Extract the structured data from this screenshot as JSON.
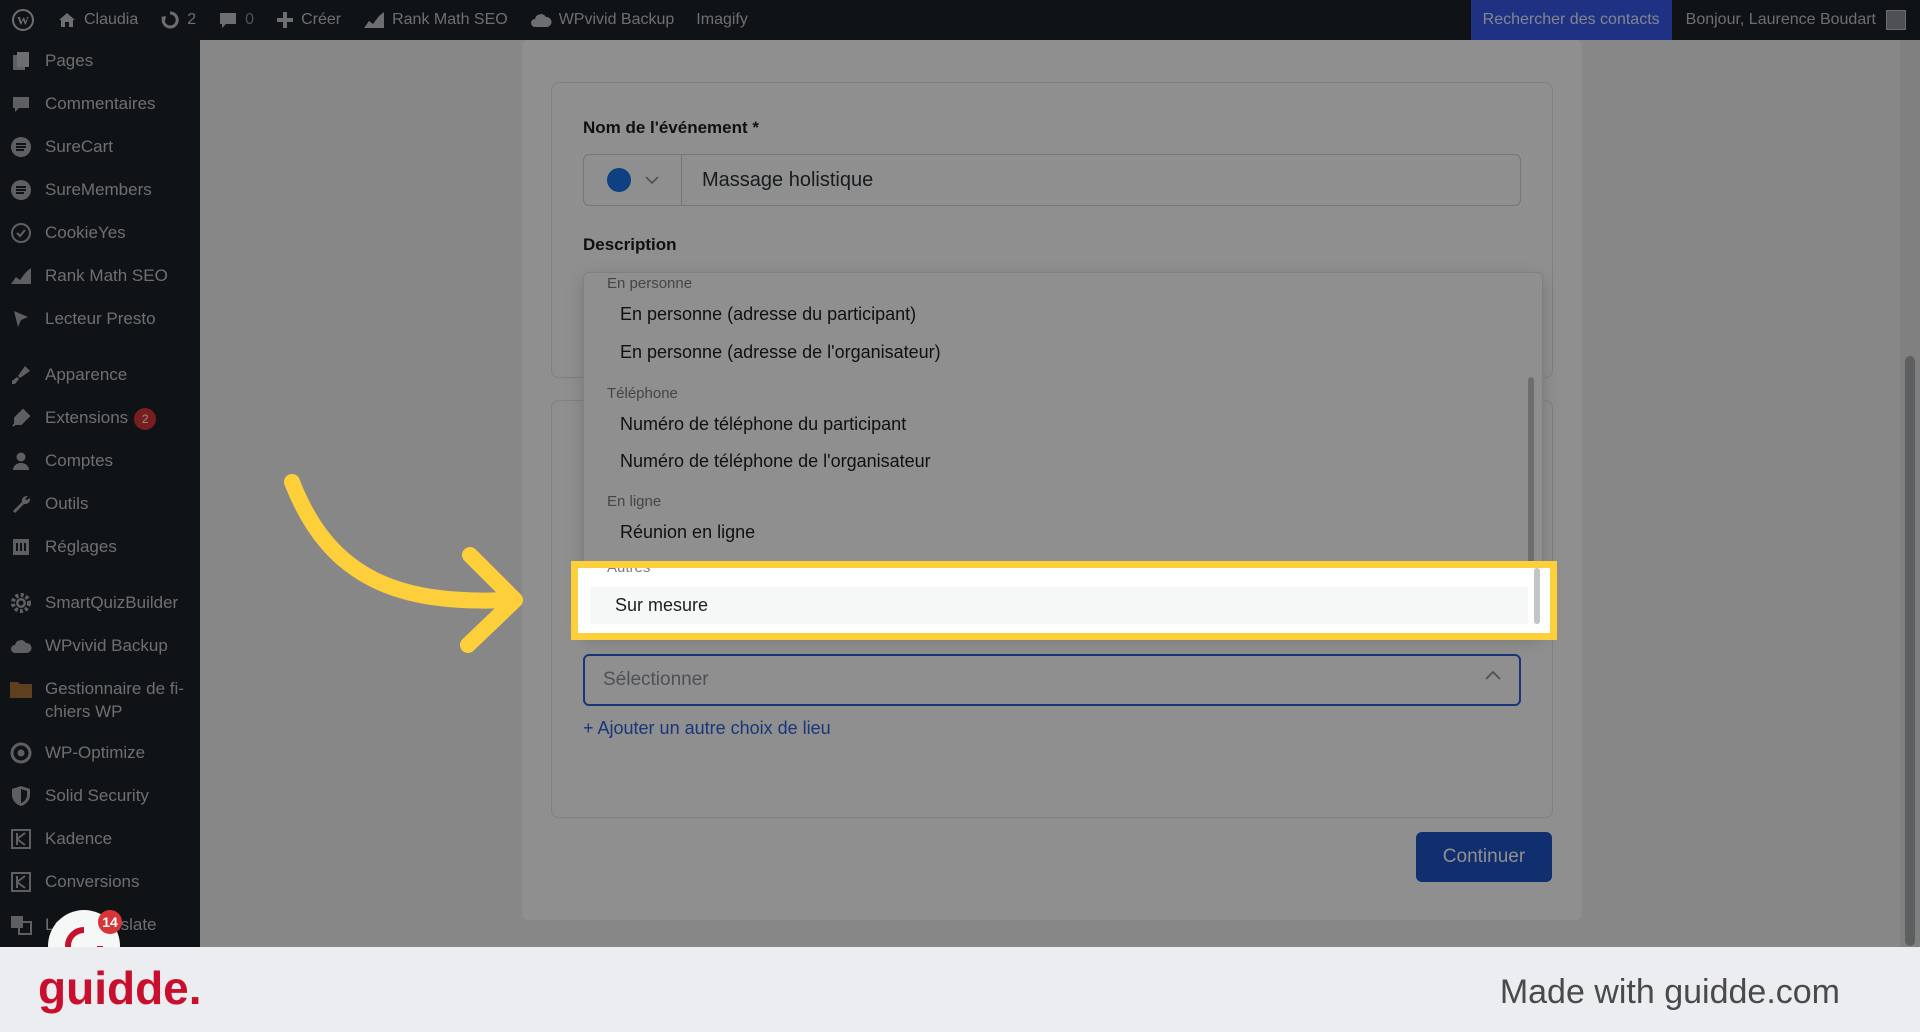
{
  "adminbar": {
    "site_name": "Claudia",
    "updates_count": "2",
    "comments_count": "0",
    "create_label": "Créer",
    "rankmath_label": "Rank Math SEO",
    "wpvivid_label": "WPvivid Backup",
    "imagify_label": "Imagify",
    "search_contacts_label": "Rechercher des contacts",
    "greeting": "Bonjour, Laurence Boudart"
  },
  "sidebar": {
    "items": [
      {
        "label": "Pages",
        "icon": "pages-icon"
      },
      {
        "label": "Commentaires",
        "icon": "comments-icon"
      },
      {
        "label": "SureCart",
        "icon": "surecart-icon"
      },
      {
        "label": "SureMembers",
        "icon": "suremembers-icon"
      },
      {
        "label": "CookieYes",
        "icon": "cookieyes-icon"
      },
      {
        "label": "Rank Math SEO",
        "icon": "rankmath-icon"
      },
      {
        "label": "Lecteur Presto",
        "icon": "presto-icon"
      },
      {
        "label": "Apparence",
        "icon": "appearance-icon"
      },
      {
        "label": "Extensions",
        "icon": "plugins-icon",
        "badge": "2"
      },
      {
        "label": "Comptes",
        "icon": "users-icon"
      },
      {
        "label": "Outils",
        "icon": "tools-icon"
      },
      {
        "label": "Réglages",
        "icon": "settings-icon"
      },
      {
        "label": "SmartQuizBuilder",
        "icon": "gear-icon"
      },
      {
        "label": "WPvivid Backup",
        "icon": "cloud-icon"
      },
      {
        "label": "Gestionnaire de fi-chiers WP",
        "icon": "folder-icon"
      },
      {
        "label": "WP-Optimize",
        "icon": "optimize-icon"
      },
      {
        "label": "Solid Security",
        "icon": "shield-icon"
      },
      {
        "label": "Kadence",
        "icon": "kadence-icon"
      },
      {
        "label": "Conversions",
        "icon": "conversions-icon"
      },
      {
        "label": "Loco Translate",
        "icon": "translate-icon"
      }
    ]
  },
  "form": {
    "event_name_label": "Nom de l'événement *",
    "event_name_value": "Massage holistique",
    "event_color": "#1a73e8",
    "description_label": "Description",
    "location_placeholder": "Sélectionner",
    "add_location_link": "+ Ajouter un autre choix de lieu",
    "continue_label": "Continuer"
  },
  "dropdown": {
    "groups": [
      {
        "label": "En personne",
        "options": [
          "En personne (adresse du participant)",
          "En personne (adresse de l'organisateur)"
        ]
      },
      {
        "label": "Téléphone",
        "options": [
          "Numéro de téléphone du participant",
          "Numéro de téléphone de l'organisateur"
        ]
      },
      {
        "label": "En ligne",
        "options": [
          "Réunion en ligne"
        ]
      },
      {
        "label": "Autres",
        "options": [
          "Sur mesure"
        ]
      }
    ],
    "highlighted": "Sur mesure"
  },
  "notification_bubble_count": "14",
  "footer": {
    "brand": "guidde.",
    "made_with": "Made with guidde.com"
  },
  "colors": {
    "highlight": "#fdd03b",
    "arrow": "#fdd03b",
    "primary": "#1f52c7",
    "brand": "#c8102e"
  }
}
